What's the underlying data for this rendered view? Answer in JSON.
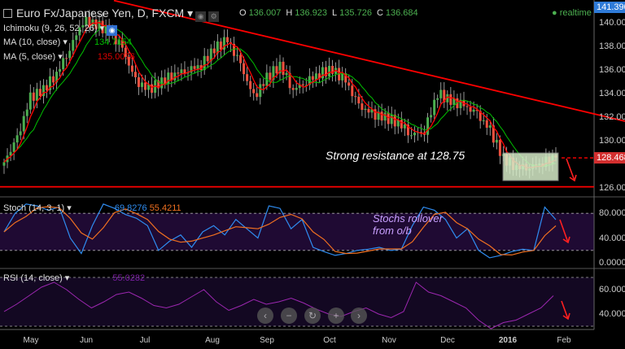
{
  "header": {
    "symbol": "Euro Fx/Japanese Yen, D, FXCM",
    "open_label": "O",
    "open": "136.007",
    "high_label": "H",
    "high": "136.923",
    "low_label": "L",
    "low": "135.726",
    "close_label": "C",
    "close": "136.684",
    "status": "realtime"
  },
  "indicators": {
    "ichimoku": "Ichimoku (9, 26, 52, 26)",
    "ma10": "MA (10, close)",
    "ma10_value": "134.7154",
    "ma5": "MA (5, close)",
    "ma5_value": "135.0076",
    "stoch": "Stoch (14, 3, 1)",
    "stoch_k": "69.8276",
    "stoch_d": "55.4211",
    "rsi": "RSI (14, close)",
    "rsi_value": "55.0282"
  },
  "annotations": {
    "resistance": "Strong resistance at 128.75",
    "stoch_note_1": "Stochs rollover",
    "stoch_note_2": "from o/b"
  },
  "price_axis": {
    "ticks": [
      "140.000",
      "138.000",
      "136.000",
      "134.000",
      "132.000",
      "130.000",
      "126.000"
    ],
    "high_tag": "141.390",
    "last_tag": "128.468"
  },
  "stoch_axis": {
    "ticks": [
      "80.0000",
      "40.0000",
      "0.0000"
    ]
  },
  "rsi_axis": {
    "ticks": [
      "60.0000",
      "40.0000"
    ]
  },
  "time_axis": {
    "labels": [
      "May",
      "Jun",
      "Jul",
      "Aug",
      "Sep",
      "Oct",
      "Nov",
      "Dec",
      "2016",
      "Feb"
    ]
  },
  "colors": {
    "up": "#4caf50",
    "down": "#f0513f",
    "ma5": "#ff0000",
    "ma10": "#00c000",
    "trend": "#ff0000",
    "stoch_k": "#2f8cf0",
    "stoch_d": "#f07020",
    "rsi": "#9c27b0",
    "band": "#1f0a33"
  },
  "chart_data": [
    {
      "type": "candlestick",
      "title": "Euro Fx/Japanese Yen, D, FXCM",
      "ylim": [
        125.5,
        141.9
      ],
      "closes": [
        128.1,
        130.1,
        133.6,
        134.3,
        135.7,
        137.8,
        140.2,
        139.9,
        139.2,
        137.8,
        135.0,
        134.3,
        135.0,
        135.7,
        136.0,
        136.4,
        137.8,
        138.5,
        136.4,
        133.6,
        135.3,
        136.4,
        134.3,
        135.0,
        135.7,
        136.0,
        135.0,
        132.9,
        132.2,
        131.9,
        131.5,
        130.5,
        130.8,
        134.0,
        133.3,
        132.9,
        132.2,
        130.8,
        128.4,
        127.7,
        127.7,
        128.1,
        128.5
      ],
      "trendline": {
        "from": 141.9,
        "to": 131.6
      },
      "support": 126.0,
      "resistance": 128.468
    },
    {
      "type": "line",
      "name": "Stoch (14, 3, 1)",
      "ylim": [
        0,
        100
      ],
      "bands": [
        20,
        80
      ],
      "k": [
        50,
        80,
        95,
        92,
        85,
        90,
        40,
        15,
        60,
        95,
        88,
        78,
        72,
        60,
        20,
        35,
        45,
        25,
        50,
        60,
        45,
        70,
        55,
        40,
        92,
        88,
        55,
        70,
        25,
        18,
        12,
        15,
        20,
        22,
        25,
        20,
        22,
        60,
        90,
        85,
        70,
        40,
        55,
        20,
        8,
        12,
        18,
        22,
        20,
        90,
        69.8
      ]
    },
    {
      "type": "line",
      "name": "RSI (14, close)",
      "ylim": [
        20,
        75
      ],
      "bands": [
        30,
        70
      ],
      "values": [
        42,
        48,
        55,
        62,
        66,
        60,
        52,
        45,
        50,
        56,
        58,
        53,
        47,
        45,
        48,
        54,
        60,
        50,
        43,
        47,
        52,
        48,
        50,
        53,
        49,
        44,
        40,
        38,
        42,
        45,
        40,
        37,
        42,
        66,
        58,
        55,
        50,
        45,
        35,
        28,
        33,
        35,
        40,
        45,
        55
      ]
    }
  ]
}
